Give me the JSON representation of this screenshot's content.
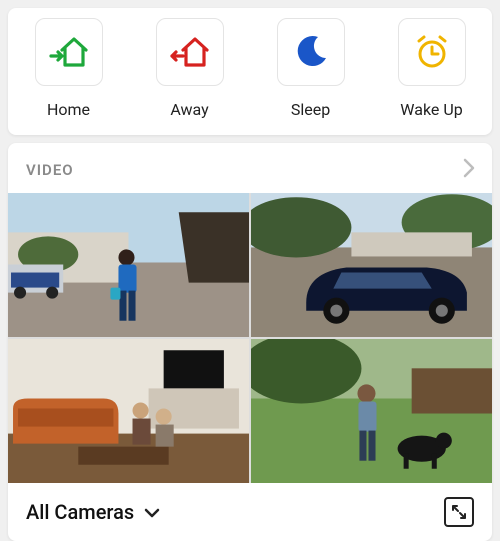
{
  "modes": [
    {
      "label": "Home",
      "icon": "house-in-icon",
      "color": "#1ea83b"
    },
    {
      "label": "Away",
      "icon": "house-out-icon",
      "color": "#d6221f"
    },
    {
      "label": "Sleep",
      "icon": "moon-icon",
      "color": "#1a56c8"
    },
    {
      "label": "Wake Up",
      "icon": "alarm-icon",
      "color": "#f0b400"
    }
  ],
  "video": {
    "section_title": "VIDEO",
    "footer_label": "All Cameras",
    "thumbs": [
      {
        "name": "camera-thumb-1"
      },
      {
        "name": "camera-thumb-2"
      },
      {
        "name": "camera-thumb-3"
      },
      {
        "name": "camera-thumb-4"
      }
    ]
  }
}
